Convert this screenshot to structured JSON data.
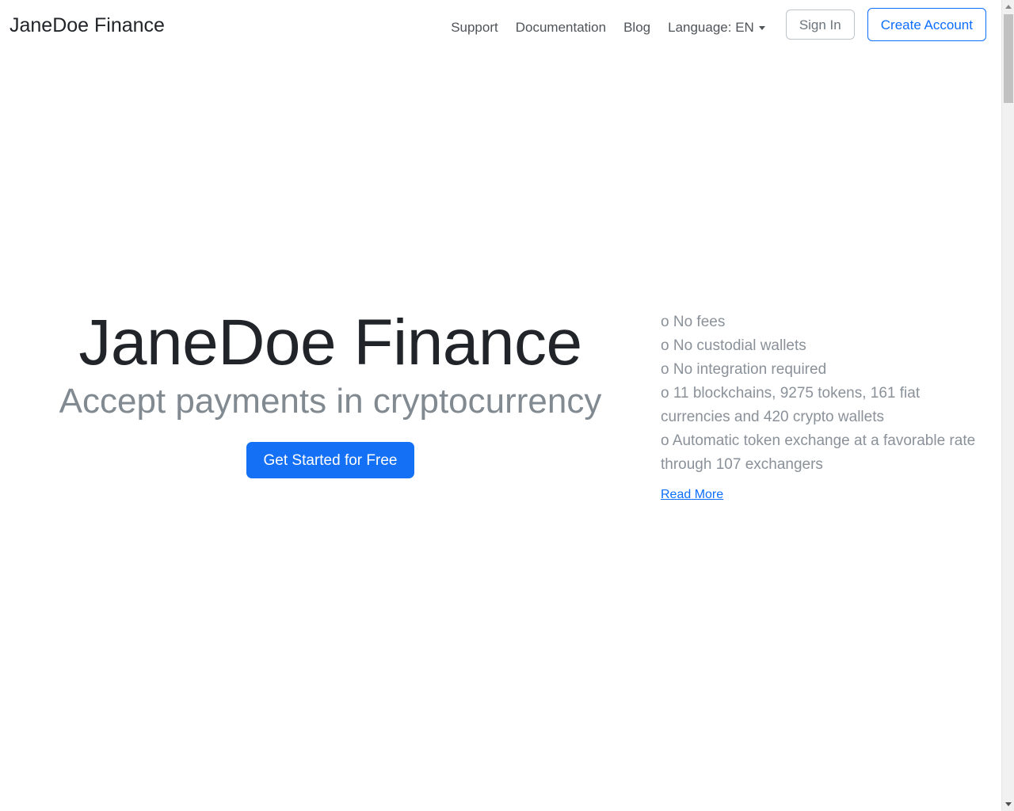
{
  "navbar": {
    "brand": "JaneDoe Finance",
    "links": [
      {
        "label": "Support"
      },
      {
        "label": "Documentation"
      },
      {
        "label": "Blog"
      }
    ],
    "language": {
      "label": "Language: EN",
      "caret_icon": "chevron-down-icon"
    },
    "sign_in_label": "Sign In",
    "create_account_label": "Create Account"
  },
  "hero": {
    "title": "JaneDoe Finance",
    "subtitle": "Accept payments in cryptocurrency",
    "cta_label": "Get Started for Free",
    "features": [
      {
        "bullet": "o",
        "text": "No fees"
      },
      {
        "bullet": "o",
        "text": "No custodial wallets"
      },
      {
        "bullet": "o",
        "text": "No integration required"
      },
      {
        "bullet": "o",
        "text": "11 blockchains, 9275 tokens, 161 fiat currencies and 420 crypto wallets"
      },
      {
        "bullet": "o",
        "text": "Automatic token exchange at a favorable rate through 107 exchangers"
      }
    ],
    "read_more_label": "Read More"
  },
  "scrollbar": {
    "up_arrow_icon": "triangle-up-icon",
    "down_arrow_icon": "triangle-down-icon"
  },
  "colors": {
    "primary_blue": "#1470f5",
    "link_blue": "#0d6efd",
    "muted_gray": "#8a9199",
    "nav_gray": "#4f5459",
    "text_dark": "#212529"
  }
}
